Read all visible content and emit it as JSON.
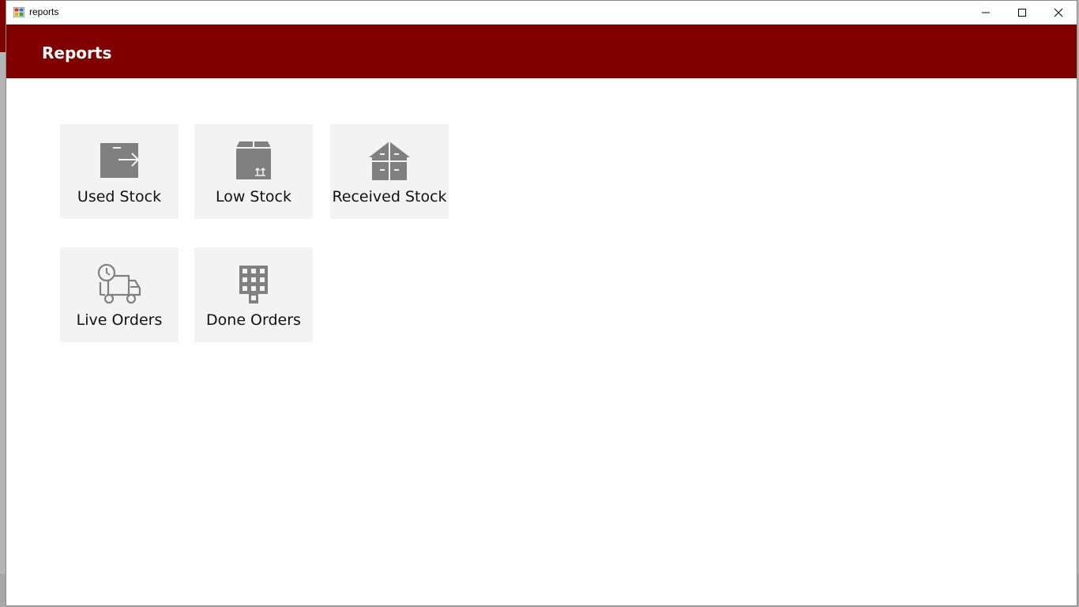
{
  "window": {
    "title": "reports"
  },
  "header": {
    "title": "Reports"
  },
  "tiles": [
    {
      "label": "Used Stock",
      "icon": "box-arrow-icon"
    },
    {
      "label": "Low Stock",
      "icon": "box-up-icon"
    },
    {
      "label": "Received Stock",
      "icon": "open-box-icon"
    },
    {
      "label": "Live Orders",
      "icon": "delivery-truck-clock-icon"
    },
    {
      "label": "Done Orders",
      "icon": "building-grid-icon"
    }
  ],
  "colors": {
    "header_bg": "#800000",
    "tile_bg": "#f3f3f3",
    "icon_gray": "#808080"
  }
}
